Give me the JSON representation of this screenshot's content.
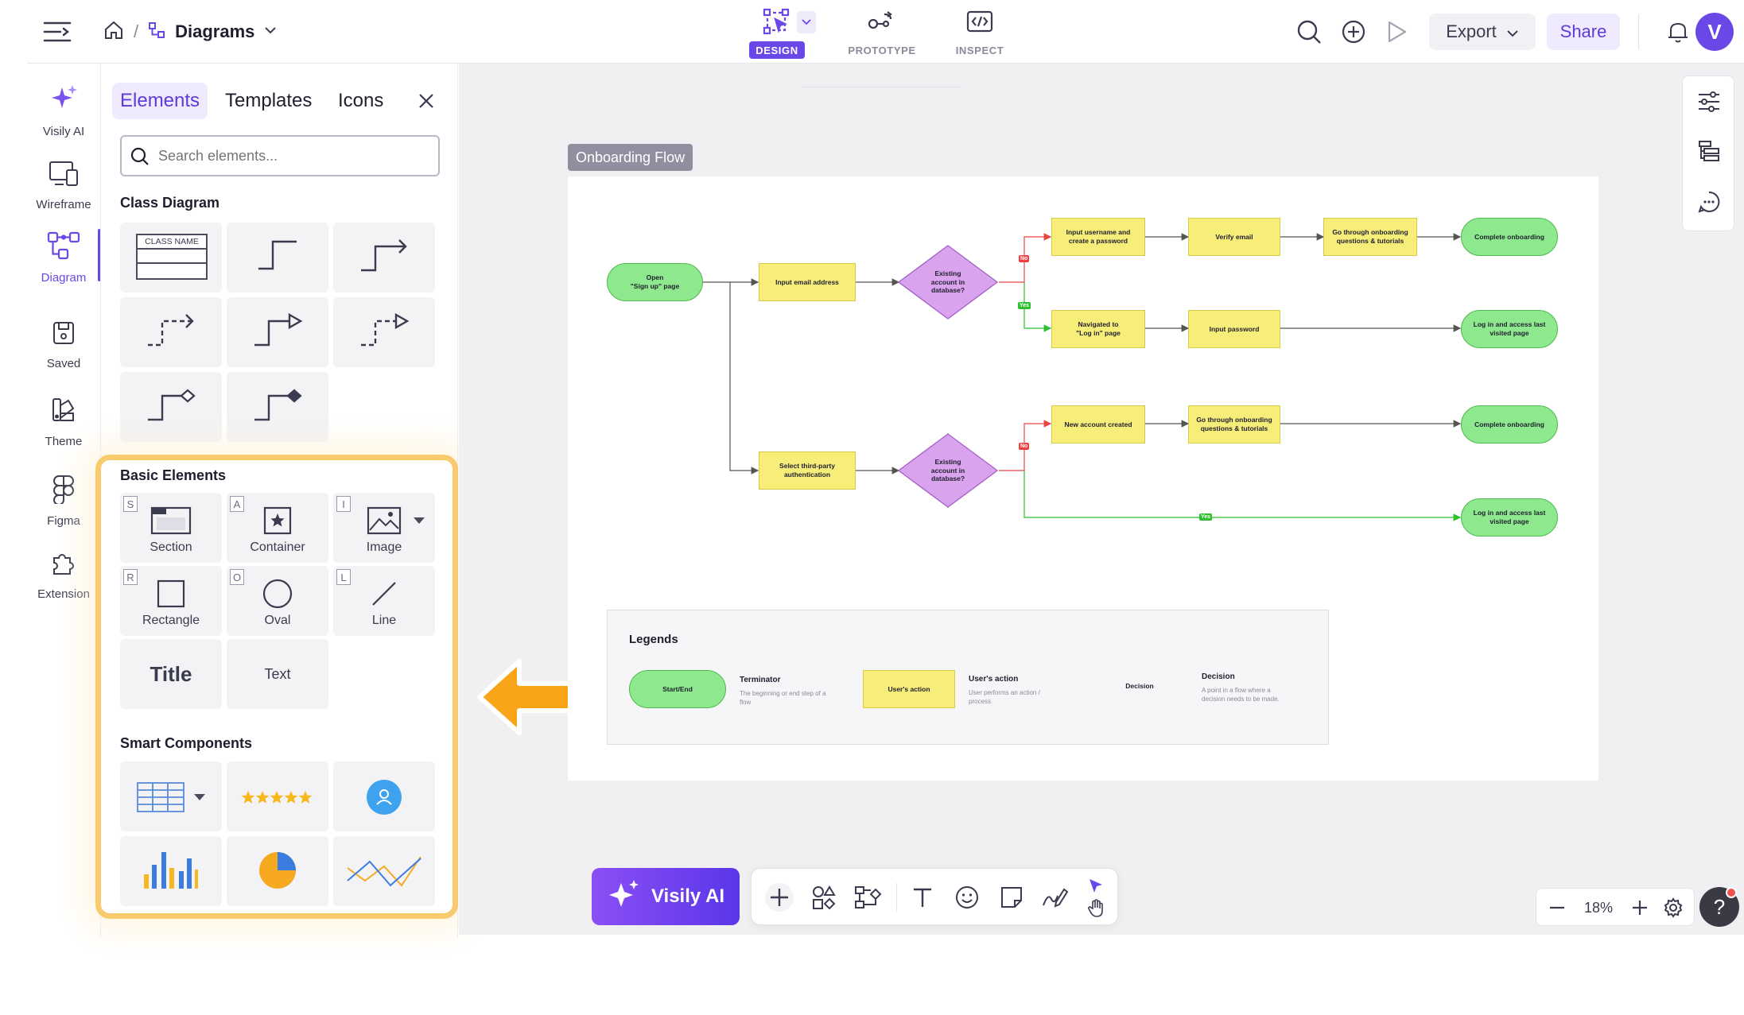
{
  "breadcrumb": {
    "title": "Diagrams"
  },
  "modes": [
    {
      "label": "DESIGN",
      "active": true
    },
    {
      "label": "PROTOTYPE",
      "active": false
    },
    {
      "label": "INSPECT",
      "active": false
    }
  ],
  "header_actions": {
    "export_label": "Export",
    "share_label": "Share",
    "avatar_letter": "V"
  },
  "rail": [
    {
      "label": "Visily AI",
      "icon": "sparkle-icon"
    },
    {
      "label": "Wireframe",
      "icon": "wireframe-icon"
    },
    {
      "label": "Diagram",
      "icon": "diagram-icon",
      "active": true
    },
    {
      "label": "Saved",
      "icon": "saved-icon"
    },
    {
      "label": "Theme",
      "icon": "theme-icon"
    },
    {
      "label": "Figma",
      "icon": "figma-icon"
    },
    {
      "label": "Extension",
      "icon": "puzzle-icon"
    }
  ],
  "panel": {
    "tabs": [
      "Elements",
      "Templates",
      "Icons"
    ],
    "search_placeholder": "Search elements...",
    "class_diagram_title": "Class Diagram",
    "class_name_label": "CLASS NAME",
    "basic_title": "Basic Elements",
    "basic": [
      {
        "key": "S",
        "label": "Section"
      },
      {
        "key": "A",
        "label": "Container"
      },
      {
        "key": "I",
        "label": "Image"
      },
      {
        "key": "R",
        "label": "Rectangle"
      },
      {
        "key": "O",
        "label": "Oval"
      },
      {
        "key": "L",
        "label": "Line"
      }
    ],
    "title_tile": "Title",
    "text_tile": "Text",
    "smart_title": "Smart Components"
  },
  "canvas": {
    "frame_label": "Onboarding Flow",
    "nodes": {
      "open": "Open\n\"Sign up\" page",
      "input_email": "Input email address",
      "dec1": "Existing\naccount in\ndatabase?",
      "input_user": "Input username and\ncreate a password",
      "verify": "Verify email",
      "go_through1": "Go through onboarding\nquestions & tutorials",
      "complete1": "Complete onboarding",
      "navigated": "Navigated to\n\"Log in\" page",
      "input_pass": "Input password",
      "login1": "Log in and access last\nvisited page",
      "third_party": "Select third-party\nauthentication",
      "dec2": "Existing\naccount in\ndatabase?",
      "new_account": "New account created",
      "go_through2": "Go through onboarding\nquestions & tutorials",
      "complete2": "Complete onboarding",
      "login2": "Log in and access last\nvisited page"
    },
    "tag_no": "No",
    "tag_yes": "Yes",
    "legend": {
      "title": "Legends",
      "start_end": "Start/End",
      "terminator": "Terminator",
      "terminator_desc": "The beginning or end step of a flow",
      "users_action_node": "User's action",
      "users_action": "User's action",
      "users_action_desc": "User performs an action / process",
      "decision_node": "Decision",
      "decision": "Decision",
      "decision_desc": "A point in a flow where a decision needs to be made."
    }
  },
  "ai_button": "Visily AI",
  "zoom": "18%",
  "help": "?",
  "colors": {
    "accent": "#6a48e8",
    "terminal": "#8ee88e",
    "action": "#f7ee7a",
    "decision": "#d9a3ee",
    "highlight": "#f9cb6e",
    "arrow": "#f9a51a"
  }
}
